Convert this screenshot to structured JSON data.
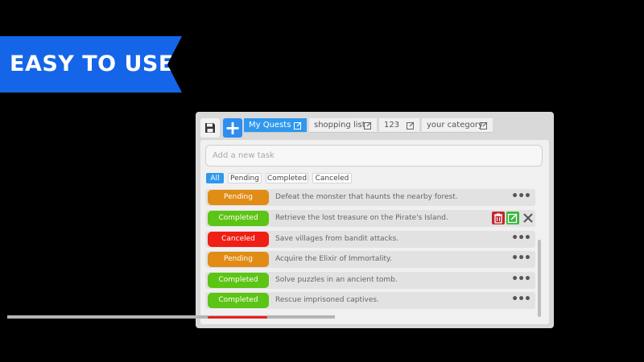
{
  "banner": {
    "text": "EASY TO USE"
  },
  "toolbar": {
    "save_icon": "floppy-disk-icon",
    "add_icon": "plus-icon",
    "add_label": "+"
  },
  "tabs": [
    {
      "label": "My Quests",
      "active": true
    },
    {
      "label": "shopping list",
      "active": false
    },
    {
      "label": "123",
      "active": false
    },
    {
      "label": "your category",
      "active": false
    }
  ],
  "new_task": {
    "placeholder": "Add a new task",
    "value": ""
  },
  "filters": [
    {
      "label": "All",
      "active": true
    },
    {
      "label": "Pending",
      "active": false
    },
    {
      "label": "Completed",
      "active": false
    },
    {
      "label": "Canceled",
      "active": false
    }
  ],
  "status_colors": {
    "Pending": "#e08c16",
    "Completed": "#5cc414",
    "Canceled": "#f01e14"
  },
  "tasks": [
    {
      "status": "Pending",
      "text": "Defeat the monster that haunts the nearby forest."
    },
    {
      "status": "Completed",
      "text": "Retrieve the lost treasure on the Pirate's Island."
    },
    {
      "status": "Canceled",
      "text": "Save villages from bandit attacks."
    },
    {
      "status": "Pending",
      "text": "Acquire the Elixir of Immortality."
    },
    {
      "status": "Completed",
      "text": "Solve puzzles in an ancient tomb."
    },
    {
      "status": "Completed",
      "text": "Rescue imprisoned captives."
    }
  ],
  "row_menu_label": "•••",
  "accent_color": "#2f98ee"
}
